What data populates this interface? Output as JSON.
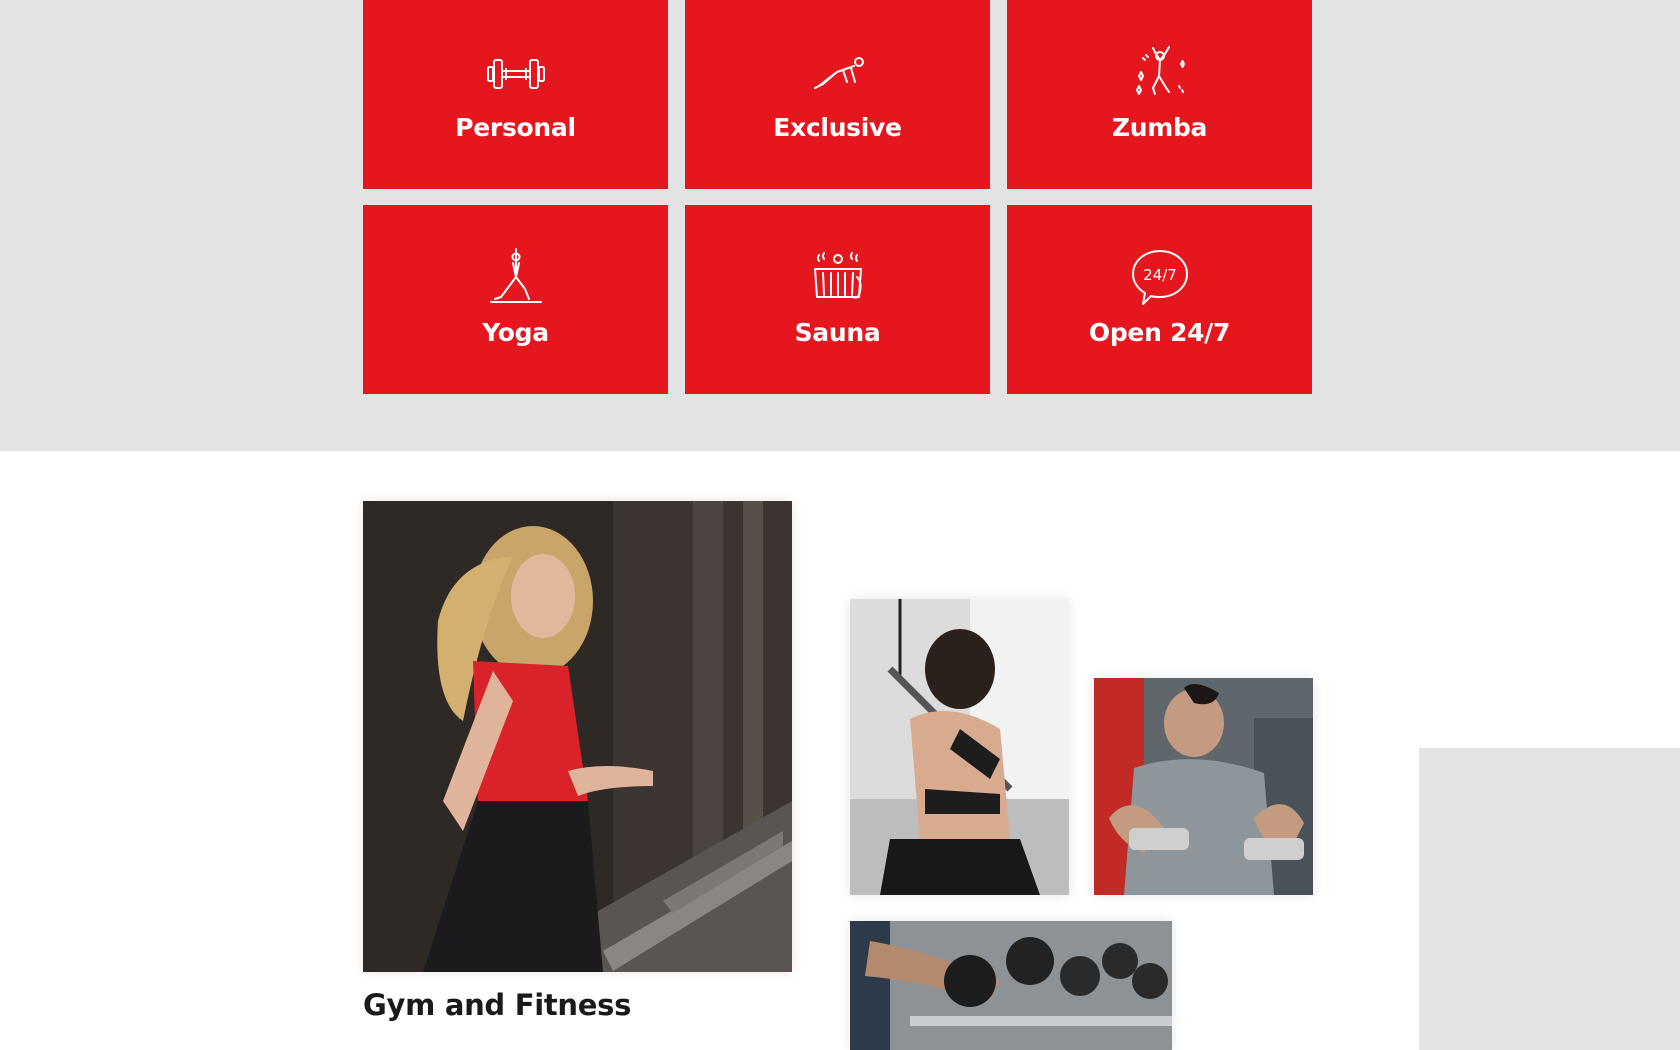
{
  "services": {
    "tiles": [
      {
        "label": "Personal",
        "icon": "dumbbell-icon"
      },
      {
        "label": "Exclusive",
        "icon": "workout-icon"
      },
      {
        "label": "Zumba",
        "icon": "dance-icon"
      },
      {
        "label": "Yoga",
        "icon": "yoga-icon"
      },
      {
        "label": "Sauna",
        "icon": "sauna-icon"
      },
      {
        "label": "Open 24/7",
        "icon": "speech-bubble-24-7-icon",
        "badge_text": "24/7"
      }
    ],
    "accent_color": "#e6161e",
    "background_color": "#e4e3e3"
  },
  "gallery": {
    "title": "Gym and Fitness",
    "photos": [
      {
        "subject": "woman running on treadmill"
      },
      {
        "subject": "woman using lat pulldown machine"
      },
      {
        "subject": "man curling dumbbells"
      },
      {
        "subject": "dumbbell rack"
      }
    ]
  }
}
